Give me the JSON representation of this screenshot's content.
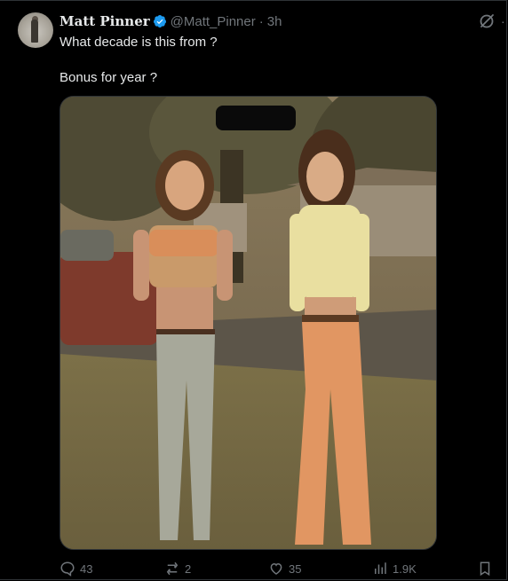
{
  "post": {
    "author_name": "Matt Pinner",
    "author_handle": "@Matt_Pinner",
    "separator": "·",
    "time": "3h",
    "text_line1": "What decade is this from ?",
    "text_line2": "Bonus for year ?",
    "verified": true
  },
  "actions": {
    "replies": "43",
    "reposts": "2",
    "likes": "35",
    "views": "1.9K"
  },
  "colors": {
    "background": "#000000",
    "text": "#e7e9ea",
    "muted": "#71767b",
    "verified_badge": "#1d9bf0",
    "border": "#2f3336"
  },
  "icons": {
    "reply": "comment-icon",
    "repost": "repost-icon",
    "like": "heart-icon",
    "views": "analytics-icon",
    "bookmark": "bookmark-icon",
    "grok": "grok-icon",
    "more": "more-icon"
  }
}
